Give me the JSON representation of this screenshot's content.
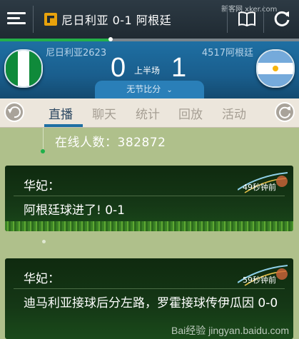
{
  "topbar": {
    "title": "尼日利亚 0-1 阿根廷",
    "watermark": "新客网 xker.com",
    "progress_fraction": 0.37
  },
  "match": {
    "home_name": "尼日利亚2623",
    "away_name": "4517阿根廷",
    "home_score": "0",
    "away_score": "1",
    "period": "上半场",
    "odds_label": "无节比分"
  },
  "tabs": [
    {
      "label": "直播"
    },
    {
      "label": "聊天"
    },
    {
      "label": "统计"
    },
    {
      "label": "回放"
    },
    {
      "label": "活动"
    }
  ],
  "feed": {
    "online_label": "在线人数：382872",
    "messages": [
      {
        "name": "华妃：",
        "time": "49秒钟前",
        "text": "阿根廷球进了! 0-1"
      },
      {
        "name": "华妃：",
        "time": "59秒钟前",
        "text": "迪马利亚接球后分左路，罗霍接球传伊瓜因 0-0"
      }
    ]
  },
  "watermark_bottom": "Bai经验 jingyan.baidu.com",
  "colors": {
    "header": "#1e6fa3",
    "accent": "#24b04a",
    "topbar": "#2d3a44"
  }
}
